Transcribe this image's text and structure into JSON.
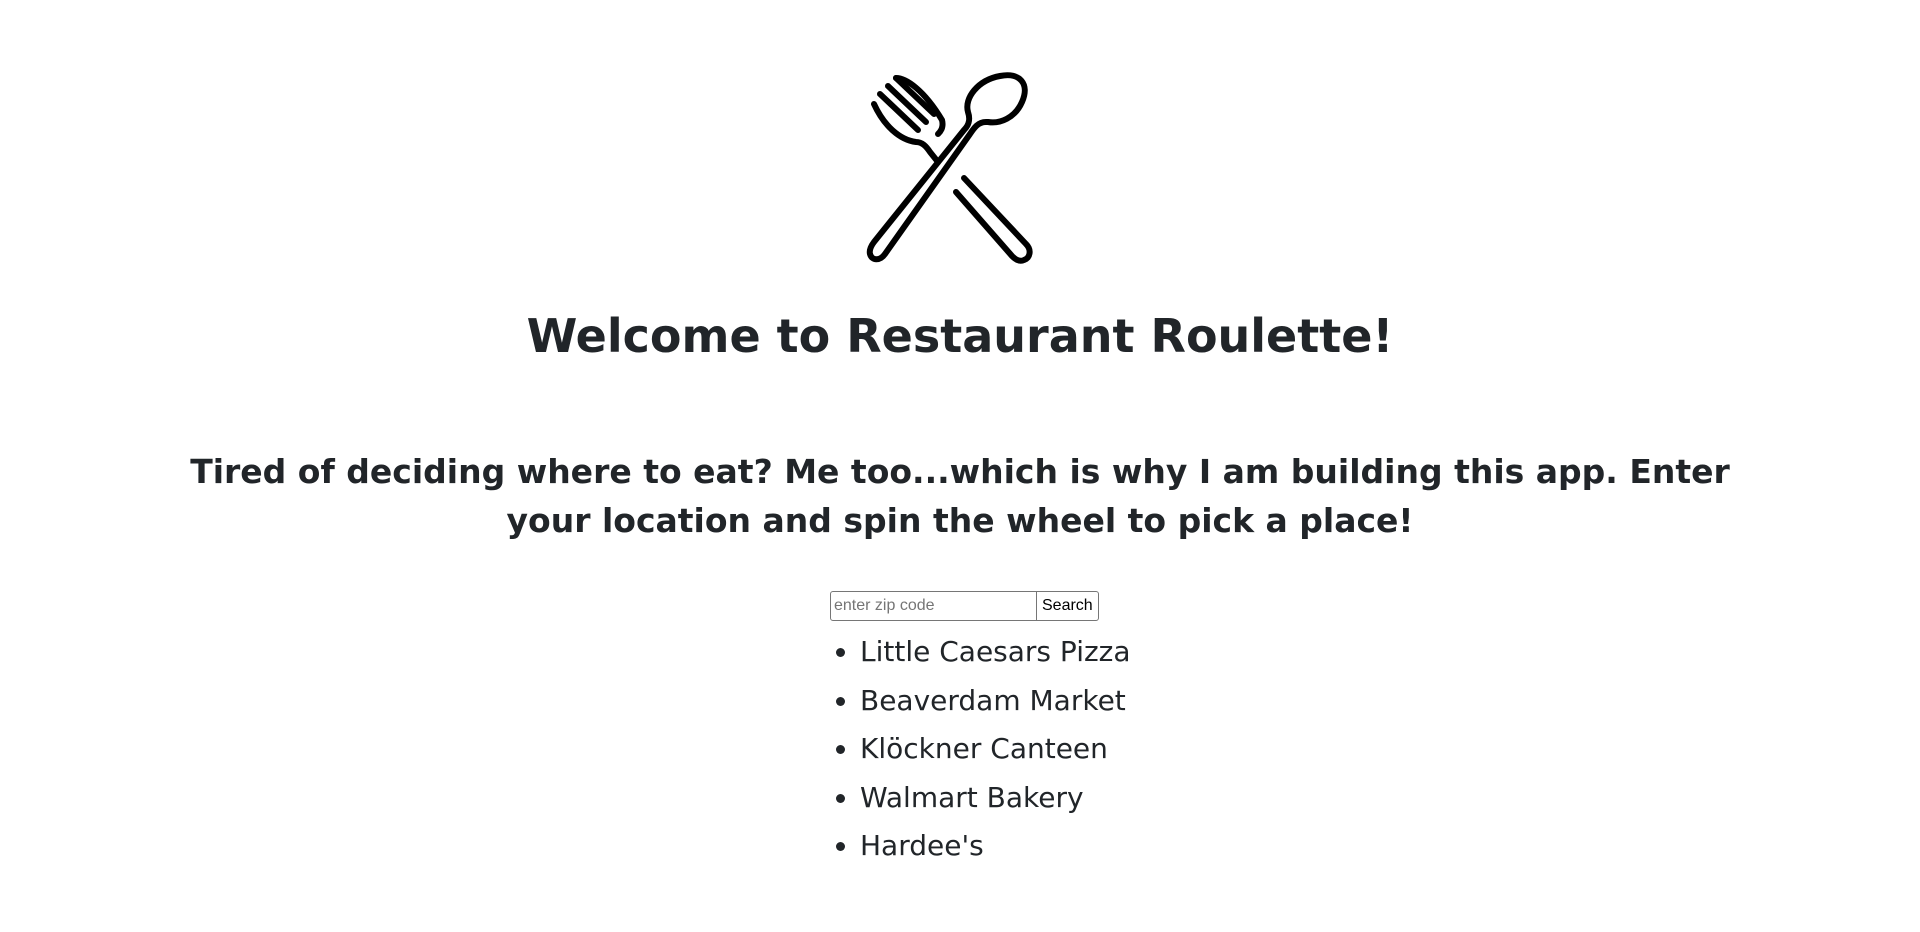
{
  "header": {
    "logo_icon": "fork-and-spoon-crossed-icon",
    "title": "Welcome to Restaurant Roulette!"
  },
  "intro": {
    "text": "Tired of deciding where to eat? Me too...which is why I am building this app. Enter your location and spin the wheel to pick a place!"
  },
  "search": {
    "placeholder": "enter zip code",
    "value": "",
    "button_label": "Search"
  },
  "results": [
    {
      "name": "Little Caesars Pizza"
    },
    {
      "name": "Beaverdam Market"
    },
    {
      "name": "Klöckner Canteen"
    },
    {
      "name": "Walmart Bakery"
    },
    {
      "name": "Hardee's"
    }
  ]
}
